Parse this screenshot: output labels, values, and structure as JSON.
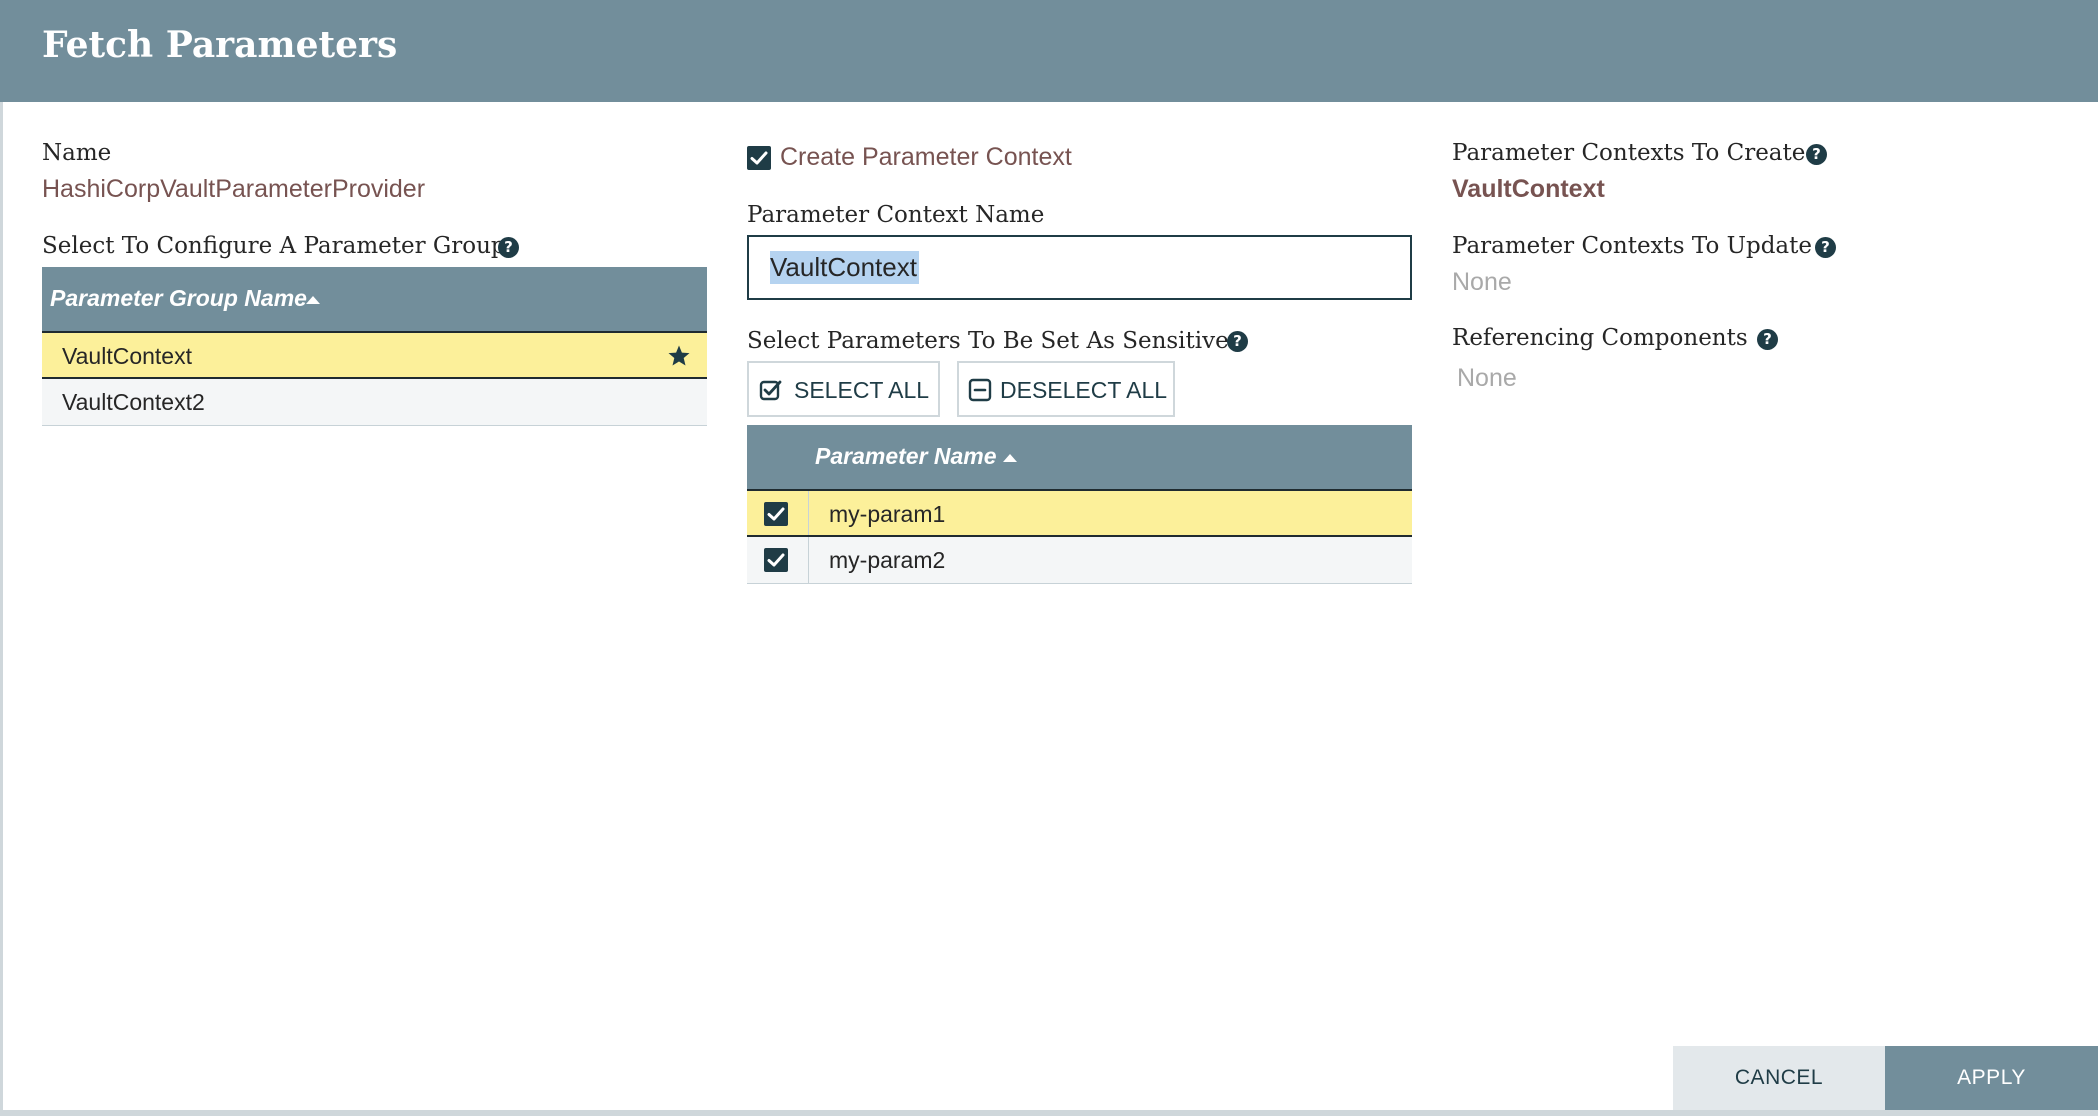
{
  "dialog": {
    "title": "Fetch Parameters"
  },
  "provider": {
    "name_label": "Name",
    "name_value": "HashiCorpVaultParameterProvider",
    "group_label": "Select To Configure A Parameter Group"
  },
  "group_table": {
    "header": "Parameter Group Name",
    "rows": [
      {
        "name": "VaultContext",
        "selected": true
      },
      {
        "name": "VaultContext2",
        "selected": false
      }
    ]
  },
  "context": {
    "create_label": "Create Parameter Context",
    "create_checked": true,
    "name_label": "Parameter Context Name",
    "name_value": "VaultContext",
    "sensitive_label": "Select Parameters To Be Set As Sensitive",
    "select_all_label": "SELECT ALL",
    "deselect_all_label": "DESELECT ALL"
  },
  "param_table": {
    "header": "Parameter Name",
    "rows": [
      {
        "name": "my-param1",
        "checked": true,
        "selected": true
      },
      {
        "name": "my-param2",
        "checked": true,
        "selected": false
      }
    ]
  },
  "summary": {
    "to_create_label": "Parameter Contexts To Create",
    "to_create_value": "VaultContext",
    "to_update_label": "Parameter Contexts To Update",
    "to_update_value": "None",
    "referencing_label": "Referencing Components",
    "referencing_value": "None"
  },
  "footer": {
    "cancel_label": "CANCEL",
    "apply_label": "APPLY"
  },
  "colors": {
    "header": "#728e9b",
    "accent": "#1f3c46",
    "value": "#775351",
    "selected_row": "#fcf09a"
  }
}
